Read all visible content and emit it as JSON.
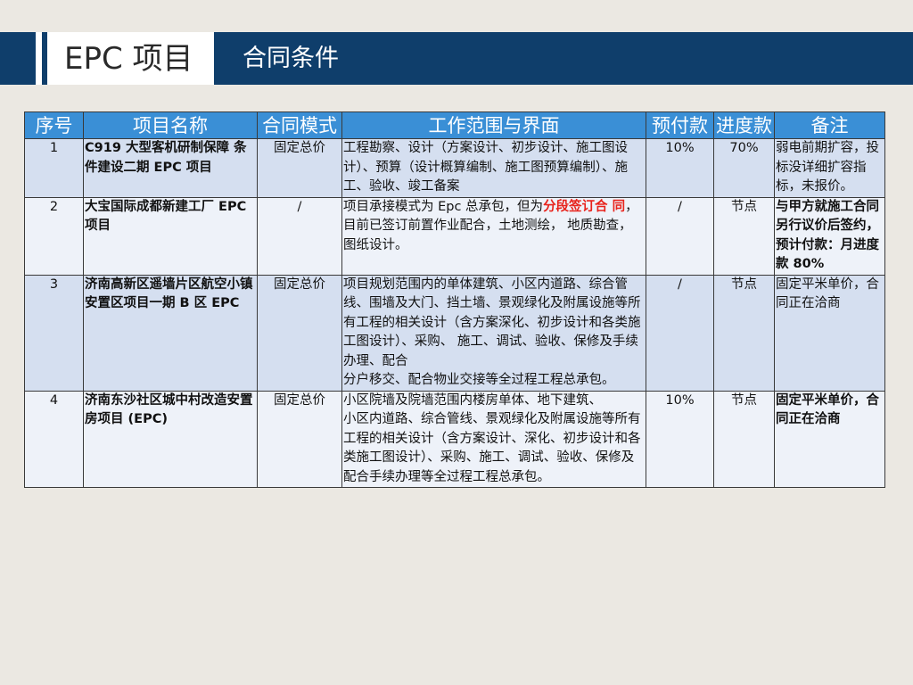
{
  "slide": {
    "title": "EPC 项目",
    "subtitle": "合同条件"
  },
  "colors": {
    "header_navy": "#0f3e6b",
    "table_header_blue": "#3a8fd6",
    "row_band": "#d5dff0",
    "row_light": "#eef2f9",
    "highlight_red": "#e8231c"
  },
  "table": {
    "headers": [
      "序号",
      "项目名称",
      "合同模式",
      "工作范围与界面",
      "预付款",
      "进度款",
      "备注"
    ],
    "rows": [
      {
        "no": "1",
        "name": "C919 大型客机研制保障 条件建设二期 EPC 项目",
        "mode": "固定总价",
        "scope": "工程勘察、设计（方案设计、初步设计、施工图设计）、预算（设计概算编制、施工图预算编制）、施工、验收、竣工备案",
        "advance": "10%",
        "progress": "70%",
        "remark": "弱电前期扩容，投标没详细扩容指标，未报价。"
      },
      {
        "no": "2",
        "name": "大宝国际成都新建工厂 EPC 项目",
        "mode": "/",
        "scope_pre": "项目承接模式为 Epc 总承包，但为",
        "scope_red": "分段签订合 同",
        "scope_post": "，目前已签订前置作业配合，土地测绘， 地质勘查，图纸设计。",
        "advance": "/",
        "progress": "节点",
        "remark": "与甲方就施工合同另行议价后签约，预计付款：月进度款 80%"
      },
      {
        "no": "3",
        "name": "济南高新区遥墙片区航空小镇安置区项目一期 B 区  EPC",
        "mode": "固定总价",
        "scope_line1": "项目规划范围内的单体建筑、小区内道路、综合管线、围墙及大门、挡土墙、景观绿化及附属设施等所有工程的相关设计（含方案深化、初步设计和各类施工图设计）、采购、 施工、调试、验收、保修及手续办理、配合",
        "scope_line2": "分户移交、配合物业交接等全过程工程总承包。",
        "advance": "/",
        "progress": "节点",
        "remark": "固定平米单价，合同正在洽商"
      },
      {
        "no": "4",
        "name": "济南东沙社区城中村改造安置房项目 (EPC)",
        "mode": "固定总价",
        "scope_line1": "小区院墙及院墙范围内楼房单体、地下建筑、",
        "scope_line2": "小区内道路、综合管线、景观绿化及附属设施等所有工程的相关设计（含方案设计、深化、初步设计和各类施工图设计）、采购、施工、调试、验收、保修及配合手续办理等全过程工程总承包。",
        "advance": "10%",
        "progress": "节点",
        "remark": "固定平米单价，合同正在洽商"
      }
    ]
  }
}
